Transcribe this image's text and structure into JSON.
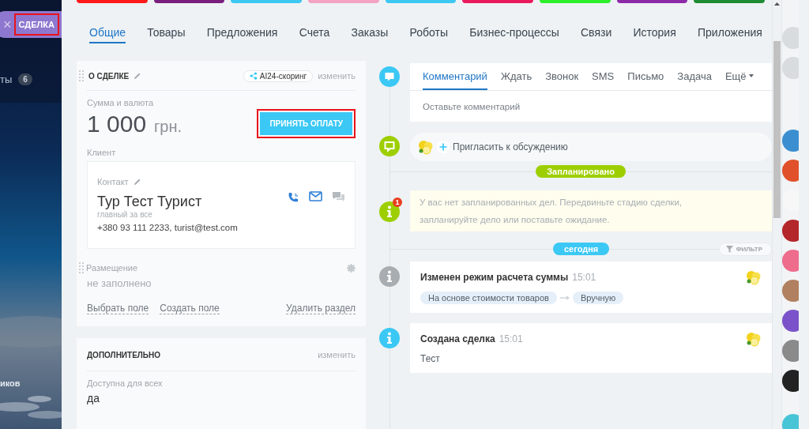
{
  "side_panel": {
    "close_label": "×",
    "deal_label": "СДЕЛКА",
    "highlighted": true,
    "menu_fragment": "ты",
    "menu_count": "6",
    "footer_fragment": "иков"
  },
  "stages": [
    {
      "color": "#ff1a1a"
    },
    {
      "color": "#7a1f7e"
    },
    {
      "color": "#3cc8f2"
    },
    {
      "color": "#f4a3c2"
    },
    {
      "color": "#3cc8f2"
    },
    {
      "color": "#ea1a5c"
    },
    {
      "color": "#2cf02c"
    },
    {
      "color": "#8c2aa8"
    },
    {
      "color": "#1f8c33"
    }
  ],
  "tabs": [
    {
      "label": "Общие",
      "selected": true
    },
    {
      "label": "Товары",
      "selected": false
    },
    {
      "label": "Предложения",
      "selected": false
    },
    {
      "label": "Счета",
      "selected": false
    },
    {
      "label": "Заказы",
      "selected": false
    },
    {
      "label": "Роботы",
      "selected": false
    },
    {
      "label": "Бизнес-процессы",
      "selected": false
    },
    {
      "label": "Связи",
      "selected": false
    },
    {
      "label": "История",
      "selected": false
    },
    {
      "label": "Приложения",
      "selected": false
    }
  ],
  "about": {
    "title": "О СДЕЛКЕ",
    "scoring": "AI24-скоринг",
    "edit": "изменить",
    "amount_label": "Сумма и валюта",
    "amount": "1 000",
    "currency": "грн.",
    "pay_button": {
      "label": "ПРИНЯТЬ ОПЛАТУ",
      "highlighted": true
    },
    "client_label": "Клиент",
    "contact": {
      "label": "Контакт",
      "name": "Тур Тест Турист",
      "role": "главный за все",
      "details": "+380 93 111 2233, turist@test.com"
    },
    "placement": {
      "label": "Размещение",
      "value": "не заполнено"
    },
    "actions": [
      "Выбрать поле",
      "Создать поле"
    ],
    "delete": "Удалить раздел"
  },
  "extra": {
    "title": "ДОПОЛНИТЕЛЬНО",
    "edit": "изменить",
    "field": {
      "label": "Доступна для всех",
      "value": "да"
    }
  },
  "timeline": {
    "composer_tabs": [
      {
        "label": "Комментарий",
        "selected": true
      },
      {
        "label": "Ждать",
        "selected": false
      },
      {
        "label": "Звонок",
        "selected": false
      },
      {
        "label": "SMS",
        "selected": false
      },
      {
        "label": "Письмо",
        "selected": false
      },
      {
        "label": "Задача",
        "selected": false
      },
      {
        "label": "Ещё",
        "selected": false
      }
    ],
    "composer_placeholder": "Оставьте комментарий",
    "invite": "Пригласить к обсуждению",
    "planned_label": "Запланировано",
    "notice_badge": "1",
    "notice": "У вас нет запланированных дел. Передвиньте стадию сделки, запланируйте дело или поставьте ожидание.",
    "today_label": "сегодня",
    "filter": "ФИЛЬТР",
    "events": [
      {
        "kind": "change",
        "title": "Изменен режим расчета суммы",
        "time": "15:01",
        "from": "На основе стоимости товаров",
        "to": "Вручную"
      },
      {
        "kind": "created",
        "title": "Создана сделка",
        "time": "15:01",
        "text": "Тест"
      }
    ]
  },
  "avatars": [
    {
      "color": "#d9dcdf"
    },
    {
      "color": "#d9dcdf"
    },
    {
      "color": "#3b8fd0"
    },
    {
      "color": "#e0512b"
    },
    {
      "color": "#f7f7f7"
    },
    {
      "color": "#b3262a"
    },
    {
      "color": "#ee6c8c"
    },
    {
      "color": "#b08060"
    },
    {
      "color": "#7b52c9"
    },
    {
      "color": "#8a8a8a"
    },
    {
      "color": "#222222"
    },
    {
      "color": "#47c4d6"
    }
  ]
}
